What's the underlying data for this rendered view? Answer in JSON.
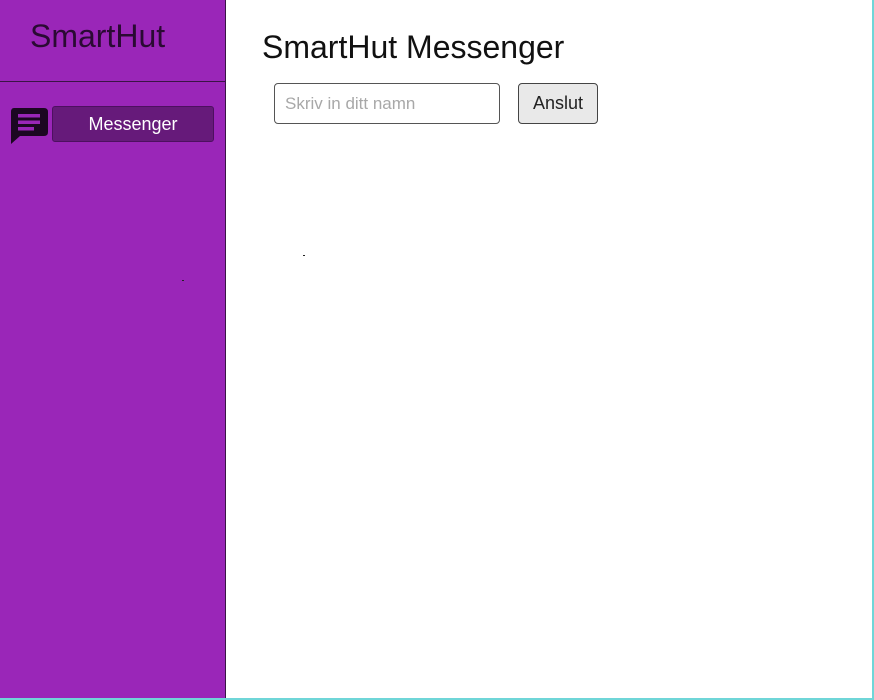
{
  "app": {
    "brand": "SmartHut"
  },
  "sidebar": {
    "items": [
      {
        "label": "Messenger",
        "icon": "chat-icon",
        "active": true
      }
    ],
    "background": "#9a26b8",
    "active_item_background": "#661a7a"
  },
  "main": {
    "title": "SmartHut Messenger",
    "name_input": {
      "value": "",
      "placeholder": "Skriv in ditt namn"
    },
    "connect_button": {
      "label": "Anslut"
    }
  }
}
